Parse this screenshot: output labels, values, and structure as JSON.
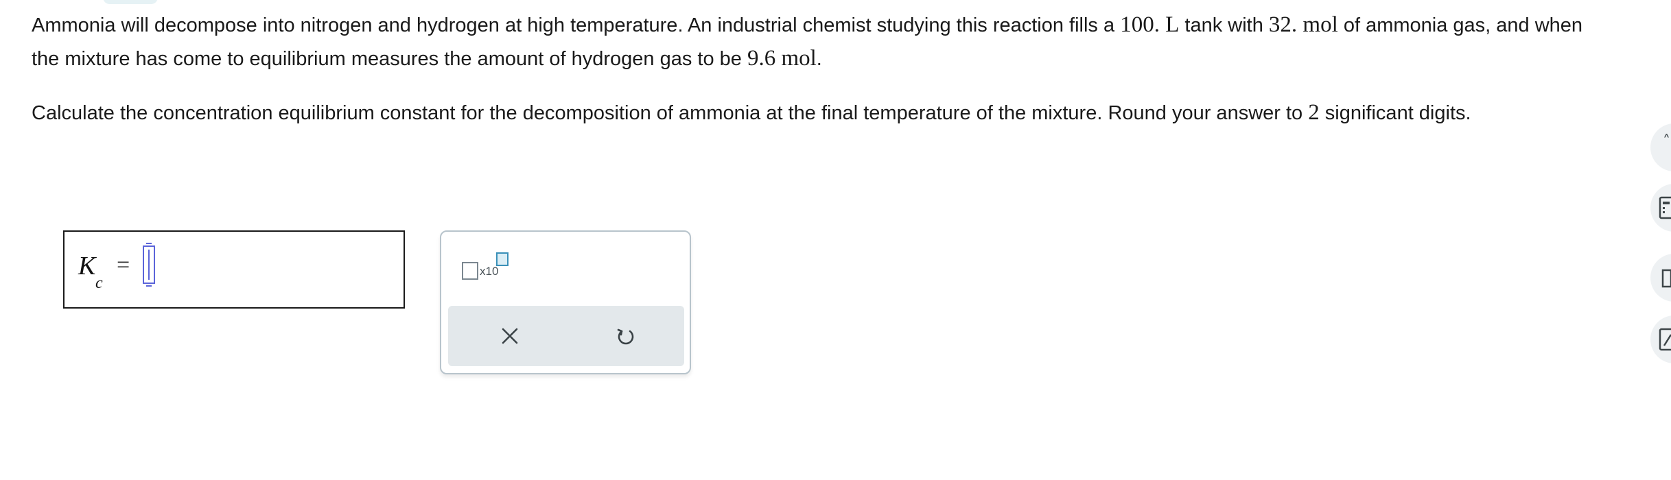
{
  "question": {
    "p1_a": "Ammonia will decompose into nitrogen and hydrogen at high temperature. An industrial chemist studying this reaction fills a ",
    "p1_vol": "100. L",
    "p1_b": " tank with ",
    "p1_mol": "32. mol",
    "p1_c": " of ammonia gas, and when the mixture has come to equilibrium measures the amount of hydrogen gas to be ",
    "p1_h2": "9.6 mol",
    "p1_d": ".",
    "p2_a": "Calculate the concentration equilibrium constant for the decomposition of ammonia at the final temperature of the mixture. Round your answer to ",
    "p2_sig": "2",
    "p2_b": " significant digits."
  },
  "answer": {
    "label_main": "K",
    "label_sub": "c",
    "equals": "=",
    "value": ""
  },
  "tools": {
    "sci_notation_label": "x10",
    "clear_icon": "close-icon",
    "undo_icon": "undo-icon"
  },
  "right_rail": {
    "icons": [
      "chevron-up-icon",
      "calculator-icon",
      "periodic-table-icon",
      "edit-icon"
    ]
  }
}
